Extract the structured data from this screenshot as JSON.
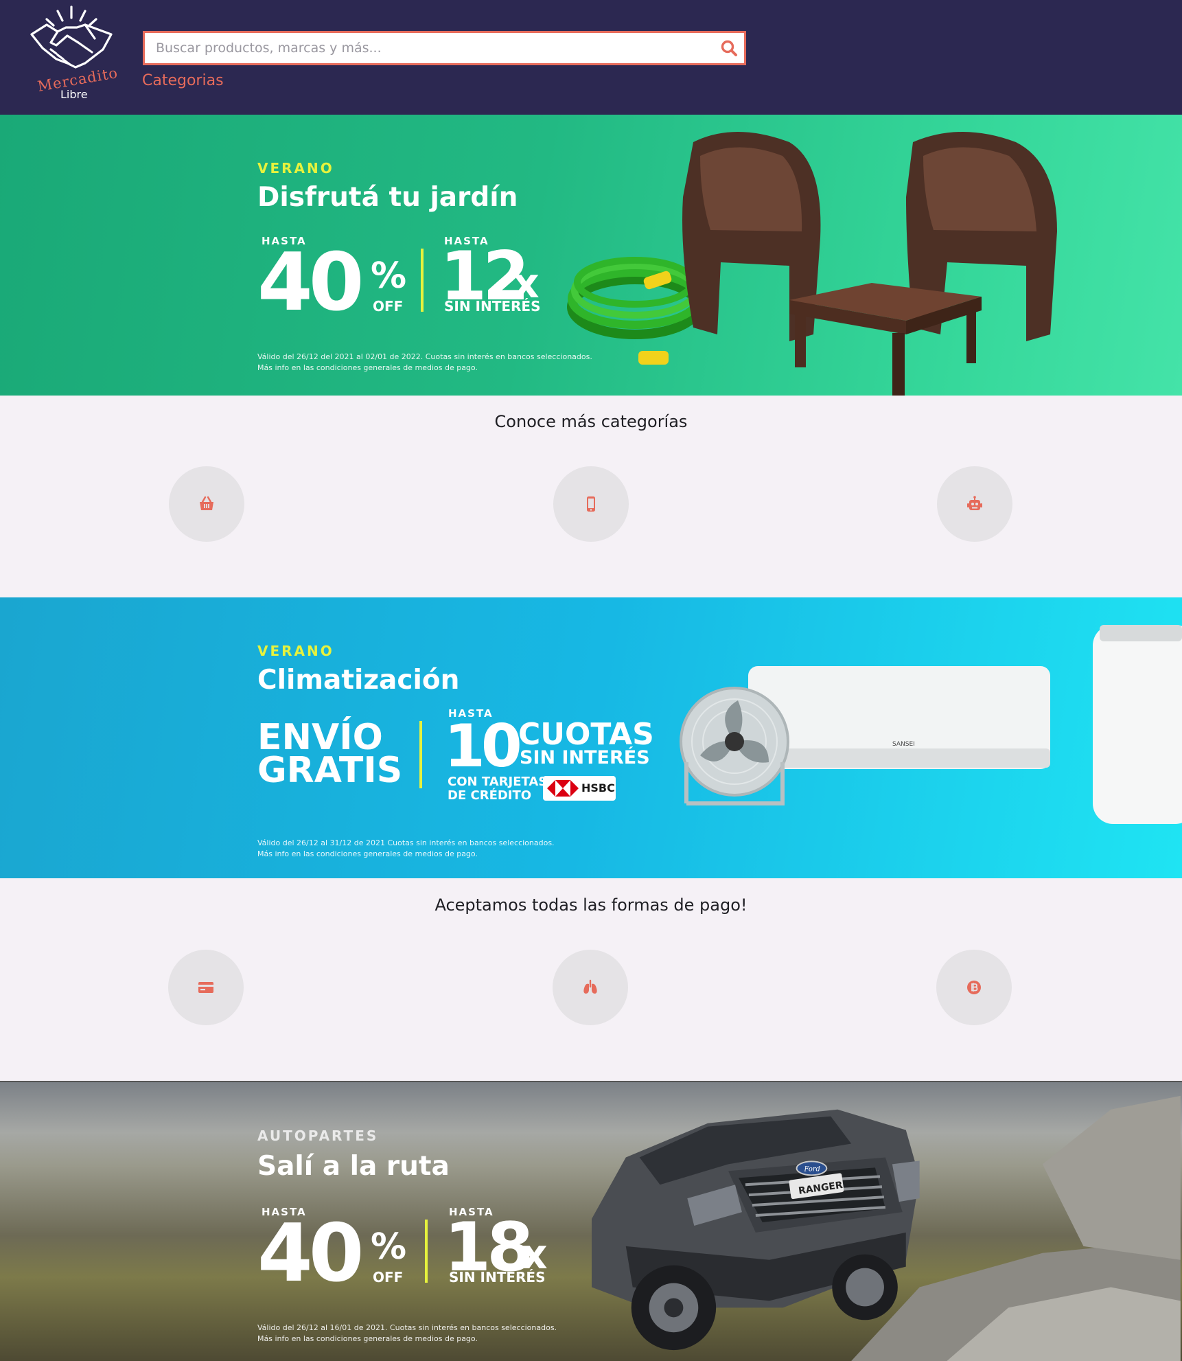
{
  "brand": {
    "name_line1": "Mercadito",
    "name_line2": "Libre"
  },
  "header": {
    "search_placeholder": "Buscar productos, marcas y más...",
    "categories_link": "Categorias"
  },
  "banners": [
    {
      "kicker": "VERANO",
      "headline": "Disfrutá tu jardín",
      "left_hasta": "HASTA",
      "left_number": "40",
      "left_percent": "%",
      "left_off": "OFF",
      "right_hasta": "HASTA",
      "right_number": "12",
      "right_x": "x",
      "right_sub": "SIN INTERÉS",
      "legal_line1": "Válido del 26/12 del 2021 al 02/01 de 2022. Cuotas sin interés en bancos seleccionados.",
      "legal_line2": "Más info en las condiciones generales de medios de pago."
    },
    {
      "kicker": "VERANO",
      "headline": "Climatización",
      "left_line1": "ENVÍO",
      "left_line2": "GRATIS",
      "right_hasta": "HASTA",
      "right_number": "10",
      "right_cuotas": "CUOTAS",
      "right_sub": "SIN INTERÉS",
      "card_line1": "CON TARJETAS",
      "card_line2": "DE CRÉDITO",
      "bank": "HSBC",
      "legal_line1": "Válido del 26/12 al 31/12 de 2021 Cuotas sin interés en bancos seleccionados.",
      "legal_line2": "Más info en las condiciones generales de medios de pago."
    },
    {
      "kicker": "AUTOPARTES",
      "headline": "Salí a la ruta",
      "left_hasta": "HASTA",
      "left_number": "40",
      "left_percent": "%",
      "left_off": "OFF",
      "right_hasta": "HASTA",
      "right_number": "18",
      "right_x": "x",
      "right_sub": "SIN INTERÉS",
      "legal_line1": "Válido del 26/12 al 16/01 de 2021. Cuotas sin interés en bancos seleccionados.",
      "legal_line2": "Más info en las condiciones generales de medios de pago.",
      "grille_badge": "RANGER",
      "brand_badge": "Ford"
    }
  ],
  "categories_section": {
    "title": "Conoce más categorías",
    "items": [
      {
        "icon": "basket-icon"
      },
      {
        "icon": "mobile-phone-icon"
      },
      {
        "icon": "robot-icon"
      }
    ]
  },
  "payments_section": {
    "title": "Aceptamos todas las formas de pago!",
    "items": [
      {
        "icon": "credit-card-icon"
      },
      {
        "icon": "lungs-icon"
      },
      {
        "icon": "bitcoin-icon"
      }
    ]
  },
  "colors": {
    "header_bg": "#2c2851",
    "accent": "#e66b5b",
    "page_bg": "#f5f1f6",
    "circle_bg": "#e5e3e6",
    "highlight_yellow": "#e6f23d"
  }
}
